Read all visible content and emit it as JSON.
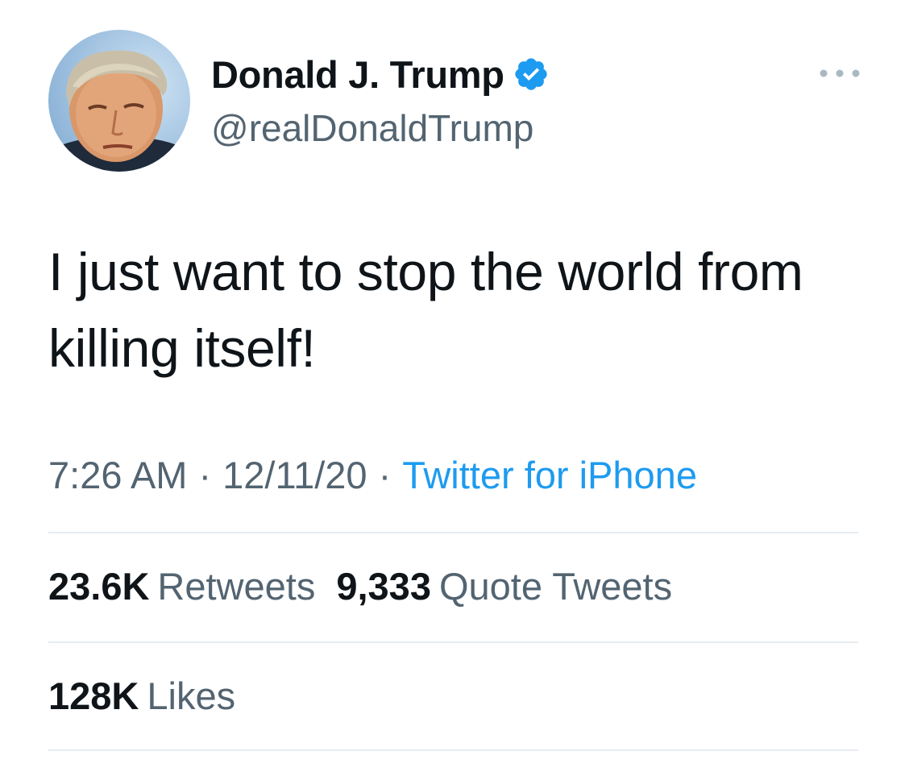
{
  "author": {
    "display_name": "Donald J. Trump",
    "handle": "@realDonaldTrump",
    "verified": true,
    "verified_color": "#1d9bf0"
  },
  "tweet": {
    "text": "I just want to stop the world from killing itself!",
    "time": "7:26 AM",
    "date": "12/11/20",
    "source": "Twitter for iPhone",
    "separator": "·"
  },
  "stats": {
    "retweets_count": "23.6K",
    "retweets_label": "Retweets",
    "quotes_count": "9,333",
    "quotes_label": "Quote Tweets",
    "likes_count": "128K",
    "likes_label": "Likes"
  },
  "icons": {
    "more": "more-horizontal-icon",
    "verified": "verified-badge-icon"
  },
  "colors": {
    "text_primary": "#0f1419",
    "text_secondary": "#536471",
    "link": "#1d9bf0",
    "divider": "#e6ecf0"
  }
}
